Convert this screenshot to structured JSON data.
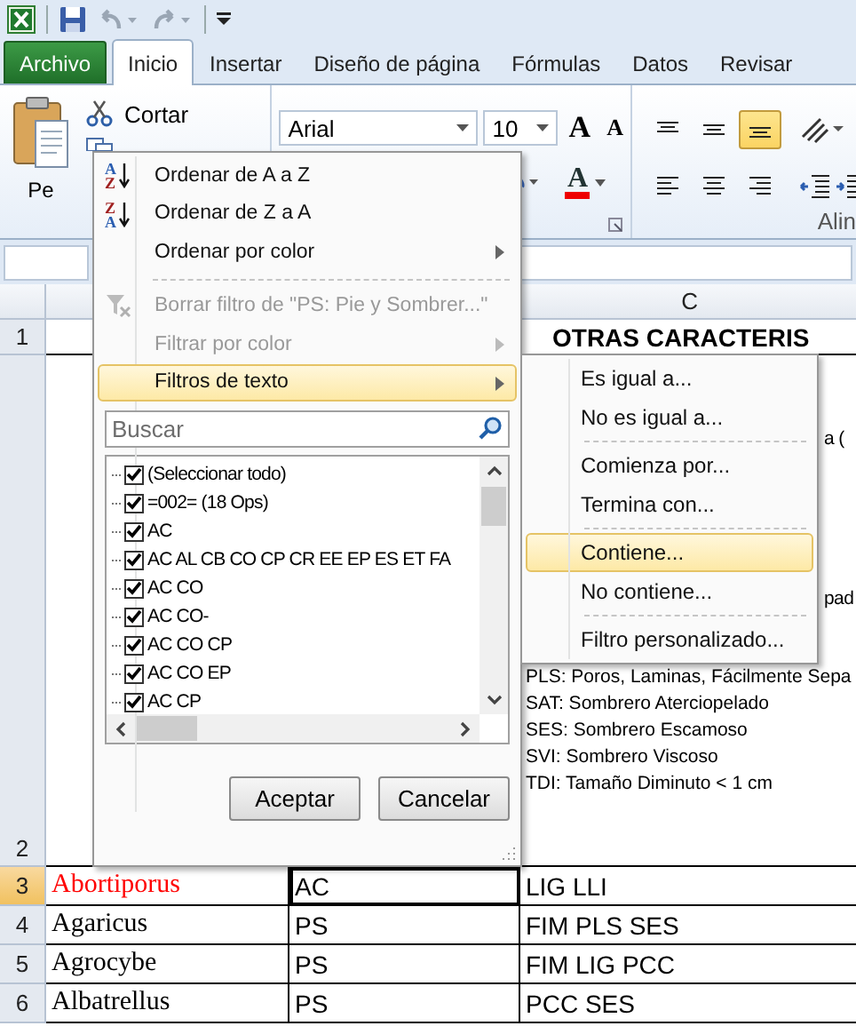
{
  "tabs": [
    {
      "label": "Archivo",
      "kind": "file",
      "selected": false
    },
    {
      "label": "Inicio",
      "kind": "tab",
      "selected": true
    },
    {
      "label": "Insertar",
      "kind": "tab",
      "selected": false
    },
    {
      "label": "Diseño de página",
      "kind": "tab",
      "selected": false
    },
    {
      "label": "Fórmulas",
      "kind": "tab",
      "selected": false
    },
    {
      "label": "Datos",
      "kind": "tab",
      "selected": false
    },
    {
      "label": "Revisar",
      "kind": "tab",
      "selected": false
    }
  ],
  "ribbon": {
    "paste_label": "Pe",
    "cut_label": "Cortar",
    "font_name": "Arial",
    "font_size": "10",
    "grow_font_glyph": "A",
    "shrink_font_glyph": "A",
    "font_color_glyph": "A",
    "alignment_group_label": "Alin"
  },
  "sheet": {
    "column_headers": [
      "C"
    ],
    "row_numbers": [
      {
        "label": "1",
        "selected": false
      },
      {
        "label": "2",
        "selected": false
      },
      {
        "label": "3",
        "selected": true
      },
      {
        "label": "4",
        "selected": false
      },
      {
        "label": "5",
        "selected": false
      },
      {
        "label": "6",
        "selected": false
      }
    ],
    "title_cell": "OTRAS CARACTERIS",
    "c2_lines": [
      {
        "text": "a (",
        "kind": "fragment"
      },
      {
        "text": "pad",
        "kind": "fragment"
      },
      {
        "text": "PLS: Poros, Laminas, Fácilmente Sepa",
        "kind": "line"
      },
      {
        "text": "SAT: Sombrero Aterciopelado",
        "kind": "line"
      },
      {
        "text": "SES: Sombrero Escamoso",
        "kind": "line"
      },
      {
        "text": "SVI: Sombrero Viscoso",
        "kind": "line"
      },
      {
        "text": "TDI: Tamaño Diminuto < 1 cm",
        "kind": "line"
      }
    ],
    "rows": [
      {
        "genus": "Abortiporus",
        "color": "#ff0000",
        "type": "AC",
        "features": "LIG LLI",
        "selected": true
      },
      {
        "genus": "Agaricus",
        "color": "#000000",
        "type": "PS",
        "features": "FIM PLS SES",
        "selected": false
      },
      {
        "genus": "Agrocybe",
        "color": "#000000",
        "type": "PS",
        "features": "FIM LIG PCC",
        "selected": false
      },
      {
        "genus": "Albatrellus",
        "color": "#000000",
        "type": "PS",
        "features": "PCC SES",
        "selected": false
      }
    ]
  },
  "filter_menu": {
    "items": [
      {
        "kind": "sort_asc",
        "label": "Ordenar de A a Z",
        "icon_letters": [
          "A",
          "Z"
        ],
        "disabled": false,
        "selected": false,
        "submenu": false
      },
      {
        "kind": "sort_desc",
        "label": "Ordenar de Z a A",
        "icon_letters": [
          "Z",
          "A"
        ],
        "disabled": false,
        "selected": false,
        "submenu": false
      },
      {
        "kind": "command",
        "label": "Ordenar por color",
        "disabled": false,
        "selected": false,
        "submenu": true
      },
      {
        "kind": "separator"
      },
      {
        "kind": "clear_filter",
        "label": "Borrar filtro de \"PS: Pie y Sombrer...\"",
        "disabled": true,
        "selected": false,
        "submenu": false
      },
      {
        "kind": "command",
        "label": "Filtrar por color",
        "disabled": true,
        "selected": false,
        "submenu": true
      },
      {
        "kind": "command",
        "label": "Filtros de texto",
        "disabled": false,
        "selected": true,
        "submenu": true
      }
    ],
    "search": {
      "placeholder": "Buscar"
    },
    "values": [
      {
        "label": "(Seleccionar todo)",
        "checked": true
      },
      {
        "label": "=002= (18 Ops)",
        "checked": true
      },
      {
        "label": "AC",
        "checked": true
      },
      {
        "label": "AC AL CB CO CP CR EE EP ES ET FA",
        "checked": true
      },
      {
        "label": "AC CO",
        "checked": true
      },
      {
        "label": "AC CO-",
        "checked": true
      },
      {
        "label": "AC CO CP",
        "checked": true
      },
      {
        "label": "AC CO EP",
        "checked": true
      },
      {
        "label": "AC CP",
        "checked": true
      }
    ],
    "buttons": [
      "Aceptar",
      "Cancelar"
    ]
  },
  "text_filters_submenu": {
    "items": [
      {
        "kind": "command",
        "label": "Es igual a...",
        "selected": false
      },
      {
        "kind": "command",
        "label": "No es igual a...",
        "selected": false
      },
      {
        "kind": "separator"
      },
      {
        "kind": "command",
        "label": "Comienza por...",
        "selected": false
      },
      {
        "kind": "command",
        "label": "Termina con...",
        "selected": false
      },
      {
        "kind": "separator"
      },
      {
        "kind": "command",
        "label": "Contiene...",
        "selected": true
      },
      {
        "kind": "command",
        "label": "No contiene...",
        "selected": false
      },
      {
        "kind": "separator"
      },
      {
        "kind": "command",
        "label": "Filtro personalizado...",
        "selected": false
      }
    ]
  }
}
